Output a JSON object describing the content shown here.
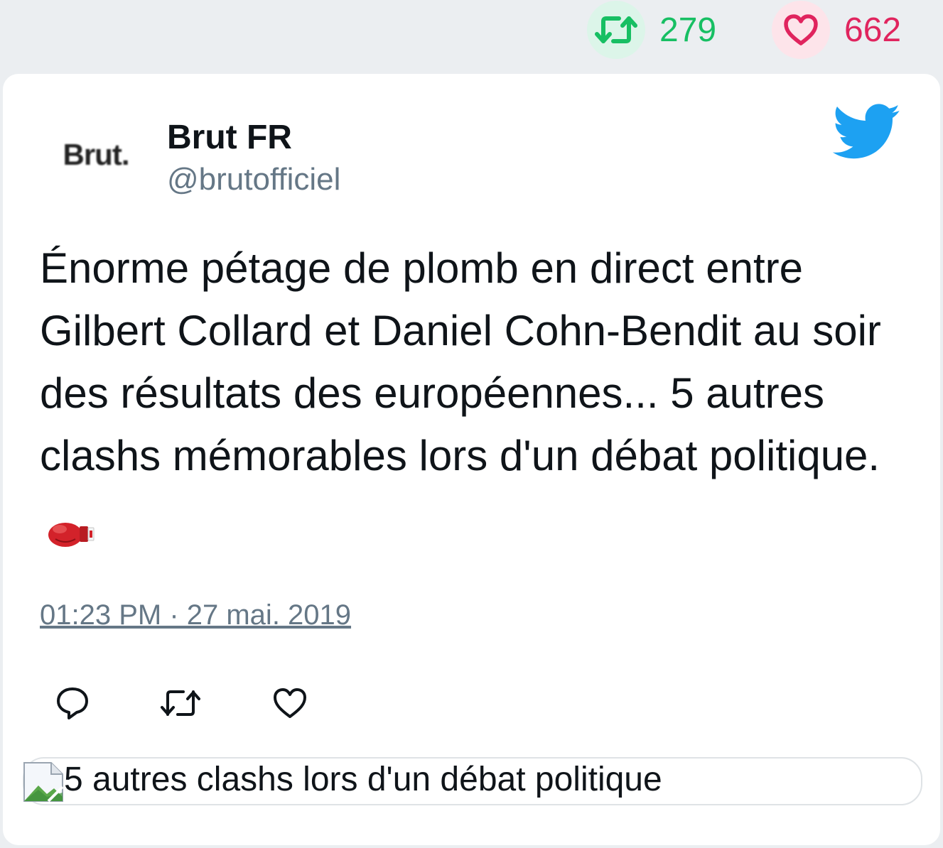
{
  "stats": {
    "retweets": "279",
    "likes": "662"
  },
  "author": {
    "avatar_text": "Brut.",
    "display_name": "Brut FR",
    "handle": "@brutofficiel"
  },
  "tweet": {
    "text": "Énorme pétage de plomb en direct entre Gilbert Collard et Daniel Cohn-Bendit au soir des résultats des européennes... 5 autres clashs mémorables lors d'un débat politique.",
    "emoji": "boxing-glove-icon",
    "timestamp": "01:23 PM · 27 mai. 2019"
  },
  "link_preview": {
    "title": "5 autres clashs lors d'un débat politique"
  },
  "colors": {
    "retweet_green": "#17bf63",
    "like_red": "#e0245e",
    "twitter_blue": "#1da1f2",
    "muted_gray": "#657786"
  }
}
